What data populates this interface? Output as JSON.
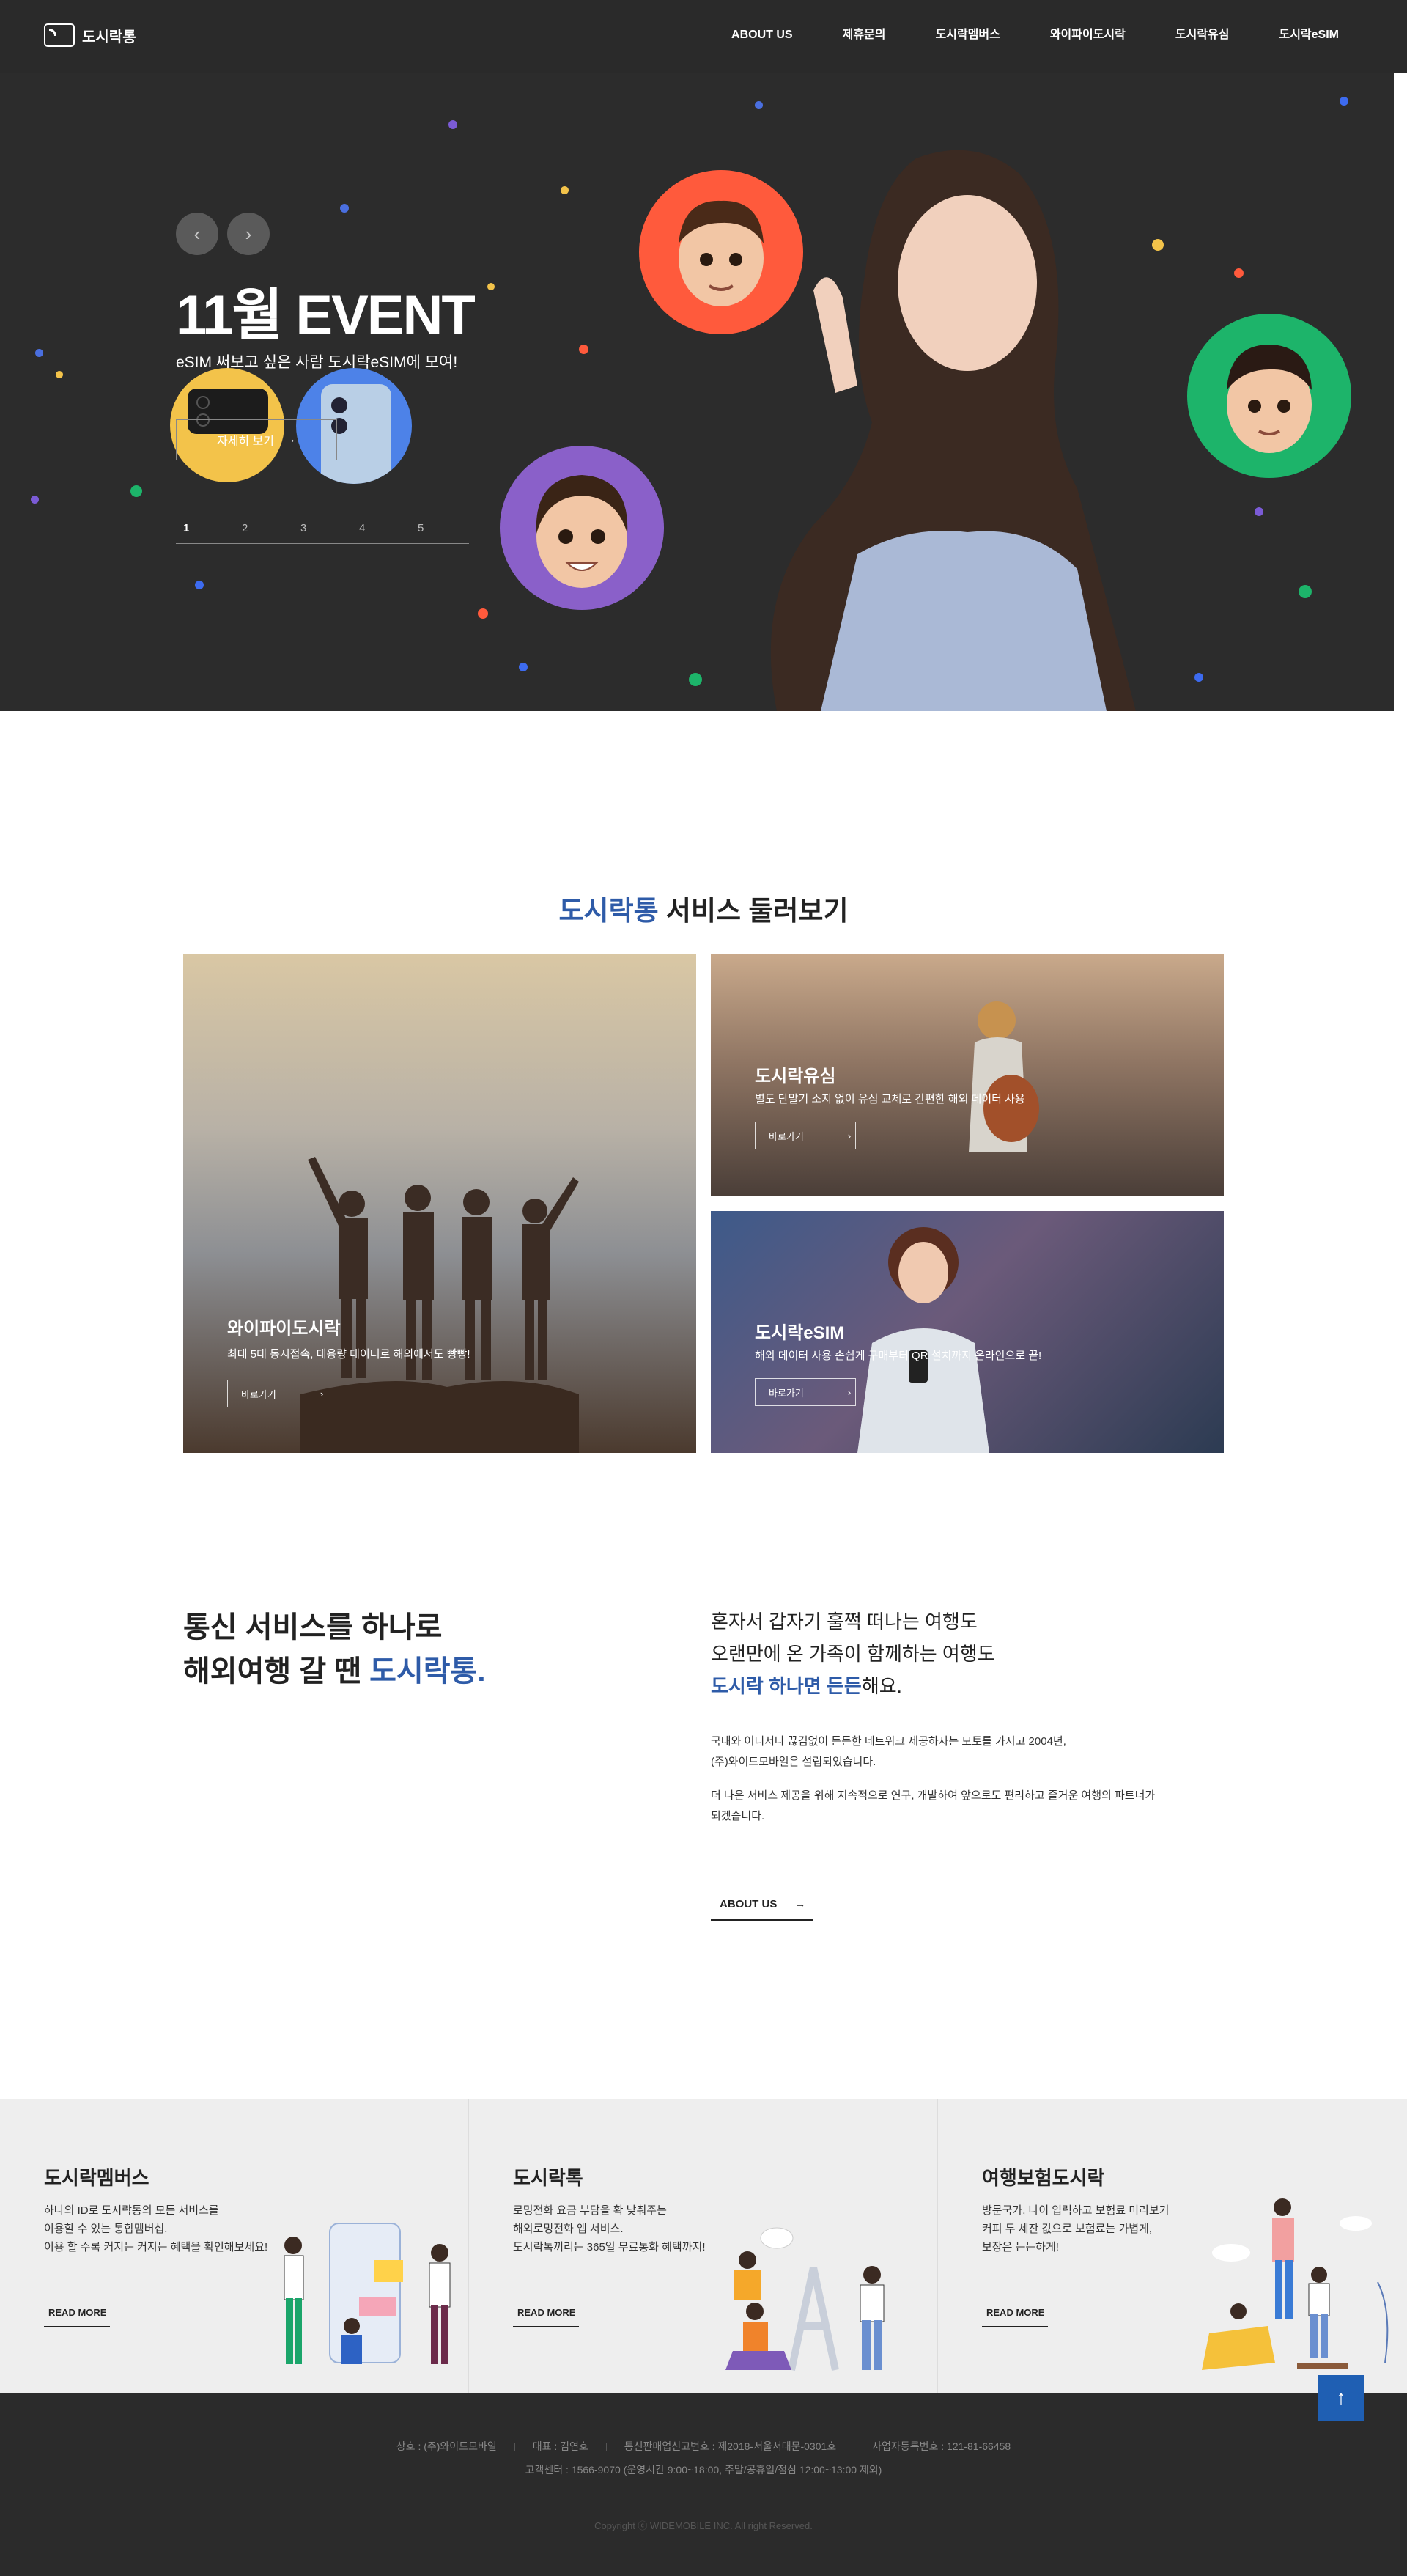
{
  "header": {
    "logo_text": "도시락통",
    "nav": [
      "ABOUT US",
      "제휴문의",
      "도시락멤버스",
      "와이파이도시락",
      "도시락유심",
      "도시락eSIM"
    ]
  },
  "hero": {
    "prev_icon": "‹",
    "next_icon": "›",
    "title": "11월 EVENT",
    "subtitle": "eSIM 써보고 싶은 사람 도시락eSIM에 모여!",
    "button_label": "자세히 보기",
    "button_arrow": "→",
    "pages": [
      "1",
      "2",
      "3",
      "4",
      "5"
    ],
    "active_page": "1"
  },
  "services": {
    "title_highlight": "도시락통",
    "title_rest": " 서비스 둘러보기",
    "cards": [
      {
        "title": "와이파이도시락",
        "desc": "최대 5대 동시접속, 대용량 데이터로 해외에서도 빵빵!",
        "button": "바로가기",
        "arrow": "›"
      },
      {
        "title": "도시락유심",
        "desc": "별도 단말기 소지 없이 유심 교체로 간편한 해외 데이터 사용",
        "button": "바로가기",
        "arrow": "›"
      },
      {
        "title": "도시락eSIM",
        "desc": "해외 데이터 사용 손쉽게 구매부터 QR 설치까지 온라인으로 끝!",
        "button": "바로가기",
        "arrow": "›"
      }
    ]
  },
  "intro": {
    "left_line1": "통신 서비스를 하나로",
    "left_line2_prefix": "해외여행 갈 땐 ",
    "left_line2_highlight": "도시락통.",
    "right_line1": "혼자서 갑자기 훌쩍 떠나는 여행도",
    "right_line2": "오랜만에 온 가족이 함께하는 여행도",
    "right_line3_highlight": "도시락 하나면 든든",
    "right_line3_rest": "해요.",
    "para1_line1": "국내와 어디서나 끊김없이 든든한 네트워크 제공하자는 모토를 가지고 2004년,",
    "para1_line2": "(주)와이드모바일은 설립되었습니다.",
    "para2_line1": "더 나은 서비스 제공을 위해 지속적으로 연구, 개발하여 앞으로도 편리하고 즐거운 여행의 파트너가",
    "para2_line2": "되겠습니다.",
    "about_button": "ABOUT US",
    "about_arrow": "→"
  },
  "promos": [
    {
      "title": "도시락멤버스",
      "desc": [
        "하나의 ID로 도시락통의 모든 서비스를",
        "이용할 수 있는 통합멤버십.",
        "이용 할 수록 커지는 커지는 혜택을 확인해보세요!"
      ],
      "button": "READ MORE"
    },
    {
      "title": "도시락톡",
      "desc": [
        "로밍전화 요금 부담을 확 낮춰주는",
        "해외로밍전화 앱 서비스.",
        "도시락톡끼리는 365일 무료통화 혜택까지!"
      ],
      "button": "READ MORE"
    },
    {
      "title": "여행보험도시락",
      "desc": [
        "방문국가, 나이 입력하고 보험료 미리보기",
        "커피 두 세잔 값으로 보험료는 가볍게,",
        "보장은 든든하게!"
      ],
      "button": "READ MORE"
    }
  ],
  "footer": {
    "company": "상호 : (주)와이드모바일",
    "ceo": "대표 : 김연호",
    "mail_order": "통신판매업신고번호 : 제2018-서울서대문-0301호",
    "biz_no": "사업자등록번호 : 121-81-66458",
    "cs": "고객센터 : 1566-9070 (운영시간 9:00~18:00, 주말/공휴일/점심 12:00~13:00 제외)",
    "copyright": "Copyright ⓒ WIDEMOBILE INC. All right Reserved."
  },
  "top_button": "↑",
  "colors": {
    "accent": "#2e5ba8",
    "header_bg": "#2a2a2a",
    "top_button": "#1f5fb3"
  }
}
